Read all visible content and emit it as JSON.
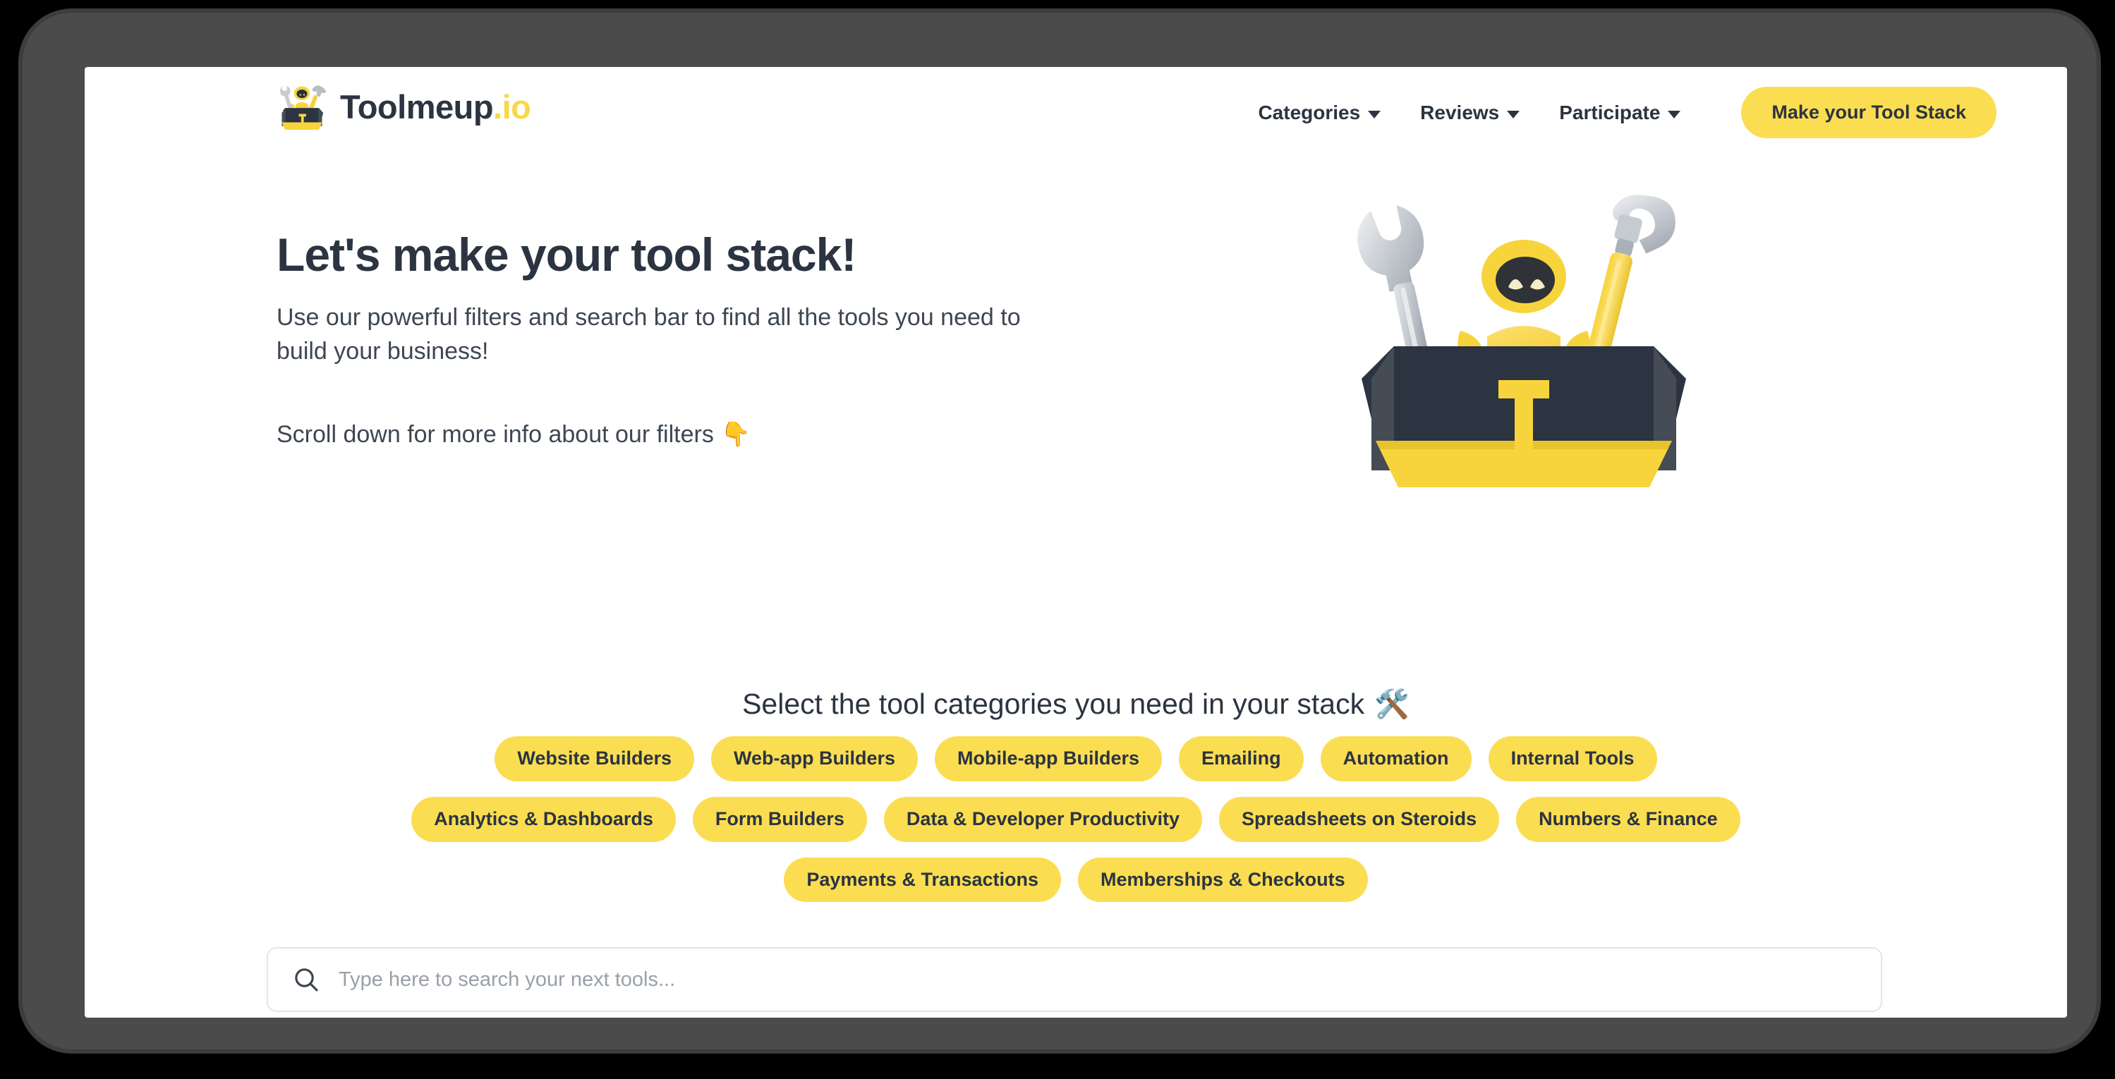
{
  "brand": {
    "name": "Toolmeup",
    "tld": ".io",
    "logo_icon": "toolbox-robot-logo-icon"
  },
  "header": {
    "nav": [
      {
        "label": "Categories",
        "icon": "chevron-down-icon"
      },
      {
        "label": "Reviews",
        "icon": "chevron-down-icon"
      },
      {
        "label": "Participate",
        "icon": "chevron-down-icon"
      }
    ],
    "cta_label": "Make your Tool Stack"
  },
  "hero": {
    "title": "Let's make your tool stack!",
    "subtitle": "Use our powerful filters and search bar to find all the tools you need to build your business!",
    "scroll_note": "Scroll down for more info about our filters",
    "scroll_note_emoji": "👇",
    "illustration_icon": "toolbox-robot-illustration"
  },
  "categories": {
    "heading": "Select the tool categories you need in your stack",
    "heading_emoji": "🛠️",
    "rows": [
      [
        {
          "label": "Website Builders"
        },
        {
          "label": "Web-app Builders"
        },
        {
          "label": "Mobile-app Builders"
        },
        {
          "label": "Emailing"
        },
        {
          "label": "Automation"
        },
        {
          "label": "Internal Tools"
        }
      ],
      [
        {
          "label": "Analytics & Dashboards"
        },
        {
          "label": "Form Builders"
        },
        {
          "label": "Data & Developer Productivity"
        },
        {
          "label": "Spreadsheets on Steroids"
        },
        {
          "label": "Numbers & Finance"
        }
      ],
      [
        {
          "label": "Payments & Transactions"
        },
        {
          "label": "Memberships & Checkouts"
        }
      ]
    ]
  },
  "search": {
    "placeholder": "Type here to search your next tools...",
    "value": "",
    "icon": "search-icon"
  },
  "colors": {
    "brand_yellow": "#fbdd52",
    "toolbox_dark": "#2b3440",
    "text_dark": "#2b3440",
    "device_frame": "#4b4b4b",
    "page_background": "#ffffff"
  }
}
